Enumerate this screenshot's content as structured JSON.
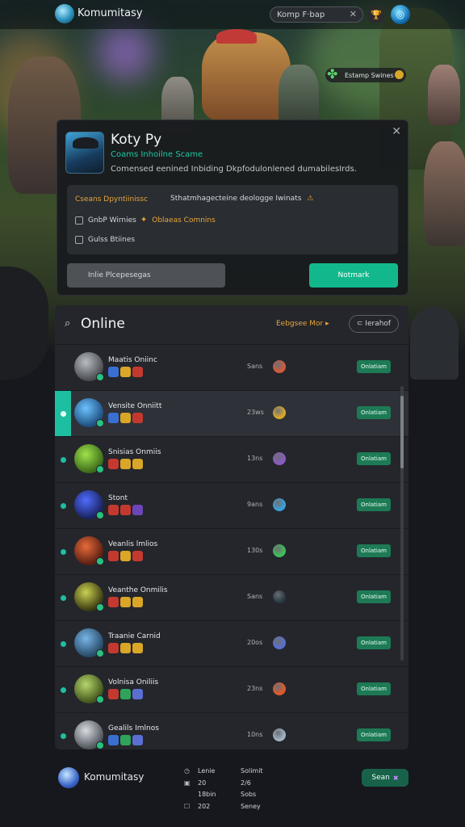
{
  "app": {
    "name": "Komumitasy"
  },
  "topbar": {
    "search_value": "Komp F·bap",
    "search_clear": "✕",
    "trophy": "🏆",
    "globe": "◎"
  },
  "event_badge": {
    "label": "Estamp Swines"
  },
  "profile": {
    "name": "Koty Py",
    "subtitle": "Coams Inhoilne Scame",
    "description": "Comensed eenined Inbiding Dkpfodulonlened dumabilesIrds.",
    "close": "✕",
    "options_title": "Cseans Dpyntiinissc",
    "options_subtitle": "Sthatmhagecteine deologge Iwinats",
    "options_subtitle_icon": "⚠",
    "option1": "GnbP Wirnies",
    "option1_icon": "✦",
    "option1_extra": "Oblaeas Comnins",
    "option2": "Gulss Btiines",
    "secondary_button": "Inlie Plcepesegas",
    "primary_button": "Notmark"
  },
  "online": {
    "search_icon": "⌕",
    "title": "Online",
    "sort_label": "Eebgsee Mor  ▸",
    "filter_label": "⊂ Ierahof",
    "rows": [
      {
        "name": "Maatis Oniinc",
        "time": "Sans",
        "action": "Onlatiam"
      },
      {
        "name": "Vensite Onniitt",
        "time": "23ws",
        "action": "Onlatiam"
      },
      {
        "name": "Snisias Onmiis",
        "time": "13ns",
        "action": "Onlatiam"
      },
      {
        "name": "Stont",
        "time": "9ans",
        "action": "Onlatiam"
      },
      {
        "name": "Veanlis lmlios",
        "time": "130s",
        "action": "Onlatiam"
      },
      {
        "name": "Veanthe Onmilis",
        "time": "Sans",
        "action": "Onlatiam"
      },
      {
        "name": "Traanie Carnid",
        "time": "20os",
        "action": "Onlatiam"
      },
      {
        "name": "Volnisa Oniliis",
        "time": "23ns",
        "action": "Onlatiam"
      },
      {
        "name": "Gealils Imlnos",
        "time": "10ns",
        "action": "Onlatiam"
      }
    ]
  },
  "footer": {
    "name": "Komumitasy",
    "rows": [
      {
        "icon": "◷",
        "a": "Lenie",
        "b": "Solimit"
      },
      {
        "icon": "▣",
        "a": "20",
        "b": "2/6"
      },
      {
        "icon": "",
        "a": "18bin",
        "b": "Sobs"
      },
      {
        "icon": "☐",
        "a": "202",
        "b": "Seney"
      }
    ],
    "send_label": "Sean",
    "send_icon": "✖"
  },
  "colors": {
    "accent": "#1ebfa0",
    "primary": "#12b88c",
    "warn": "#e6a63a",
    "panel": "#24262c"
  }
}
